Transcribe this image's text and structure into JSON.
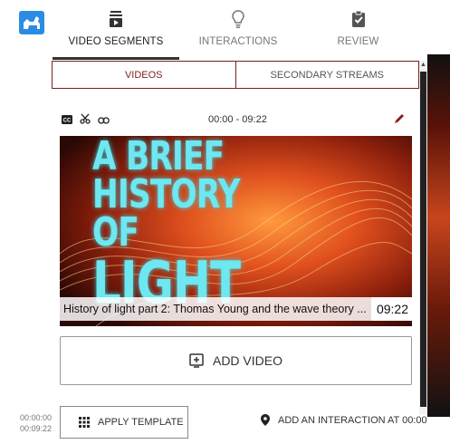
{
  "nav": {
    "tabs": [
      {
        "label": "VIDEO SEGMENTS",
        "icon": "video-list-icon",
        "active": true
      },
      {
        "label": "INTERACTIONS",
        "icon": "lightbulb-icon",
        "active": false
      },
      {
        "label": "REVIEW",
        "icon": "clipboard-check-icon",
        "active": false
      }
    ]
  },
  "subtabs": {
    "videos": "VIDEOS",
    "secondary": "SECONDARY STREAMS"
  },
  "segment": {
    "time_range": "00:00 - 09:22",
    "icons": [
      "closed-captions-icon",
      "scissors-icon",
      "link-icon",
      "pencil-icon"
    ],
    "thumbnail_title_lines": [
      "A BRIEF HISTORY",
      "OF",
      "LIGHT"
    ],
    "caption": "History of light part 2: Thomas Young and the wave theory ...",
    "duration": "09:22"
  },
  "actions": {
    "add_video": "ADD VIDEO",
    "apply_template": "APPLY TEMPLATE",
    "add_interaction": "ADD AN INTERACTION AT 00:00"
  },
  "timeline": {
    "start": "00:00:00",
    "end": "00:09:22"
  },
  "colors": {
    "accent": "#7a1f1f",
    "logo": "#2a8de3",
    "title_glow": "#6ee7f0"
  }
}
